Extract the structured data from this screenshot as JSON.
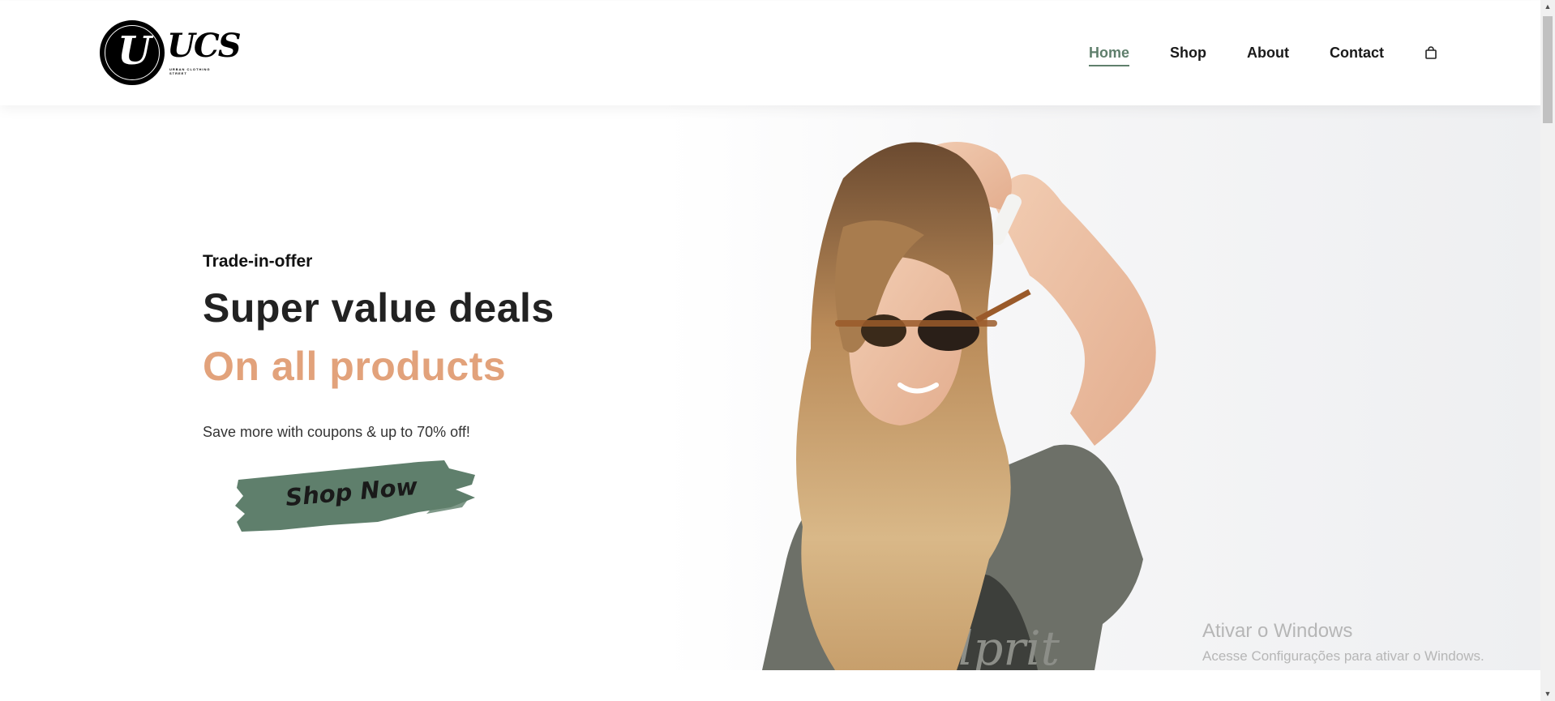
{
  "brand": {
    "logo_letter": "U",
    "logo_text": "UCS",
    "logo_tagline": "URBAN CLOTHING STREET"
  },
  "nav": {
    "items": [
      {
        "label": "Home",
        "active": true
      },
      {
        "label": "Shop",
        "active": false
      },
      {
        "label": "About",
        "active": false
      },
      {
        "label": "Contact",
        "active": false
      }
    ],
    "cart_icon": "shopping-bag-icon"
  },
  "hero": {
    "eyebrow": "Trade-in-offer",
    "headline": "Super value deals",
    "highlight": "On all products",
    "subtext": "Save more with coupons & up to 70% off!",
    "button_label": "Shop Now",
    "shirt_text": "Culprit"
  },
  "watermark": {
    "title": "Ativar o Windows",
    "subtitle": "Acesse Configurações para ativar o Windows."
  },
  "colors": {
    "accent_green": "#5f7f6c",
    "highlight_orange": "#e2a27b",
    "text_dark": "#222222"
  }
}
